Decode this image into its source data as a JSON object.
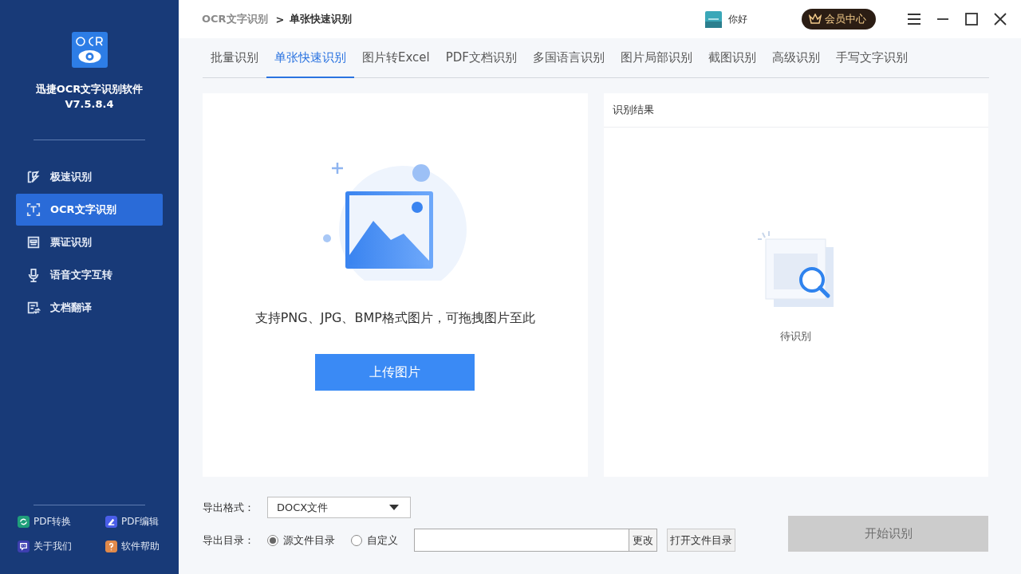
{
  "sidebar": {
    "app_name": "迅捷OCR文字识别软件",
    "version": "V7.5.8.4",
    "items": [
      {
        "label": "极速识别",
        "selected": false
      },
      {
        "label": "OCR文字识别",
        "selected": true
      },
      {
        "label": "票证识别",
        "selected": false
      },
      {
        "label": "语音文字互转",
        "selected": false
      },
      {
        "label": "文档翻译",
        "selected": false
      }
    ],
    "footer_links": [
      {
        "label": "PDF转换",
        "color": "#1f9e7a"
      },
      {
        "label": "PDF编辑",
        "color": "#4a5ee8"
      },
      {
        "label": "关于我们",
        "color": "#3d3fb0"
      },
      {
        "label": "软件帮助",
        "color": "#e0894a"
      }
    ]
  },
  "header": {
    "breadcrumb": [
      "OCR文字识别",
      "单张快速识别"
    ],
    "separator": ">",
    "greeting": "你好",
    "vip_button": "会员中心"
  },
  "tabs": [
    {
      "label": "批量识别",
      "selected": false
    },
    {
      "label": "单张快速识别",
      "selected": true
    },
    {
      "label": "图片转Excel",
      "selected": false
    },
    {
      "label": "PDF文档识别",
      "selected": false
    },
    {
      "label": "多国语言识别",
      "selected": false
    },
    {
      "label": "图片局部识别",
      "selected": false
    },
    {
      "label": "截图识别",
      "selected": false
    },
    {
      "label": "高级识别",
      "selected": false
    },
    {
      "label": "手写文字识别",
      "selected": false
    }
  ],
  "upload_panel": {
    "hint": "支持PNG、JPG、BMP格式图片，可拖拽图片至此",
    "button": "上传图片"
  },
  "result_panel": {
    "title": "识别结果",
    "status": "待识别"
  },
  "export": {
    "format_label": "导出格式：",
    "format_value": "DOCX文件",
    "dir_label": "导出目录：",
    "dir_options": [
      {
        "label": "源文件目录",
        "selected": true
      },
      {
        "label": "自定义",
        "selected": false
      }
    ],
    "change_button": "更改",
    "open_dir_button": "打开文件目录",
    "start_button": {
      "label": "开始识别",
      "disabled": true
    }
  }
}
